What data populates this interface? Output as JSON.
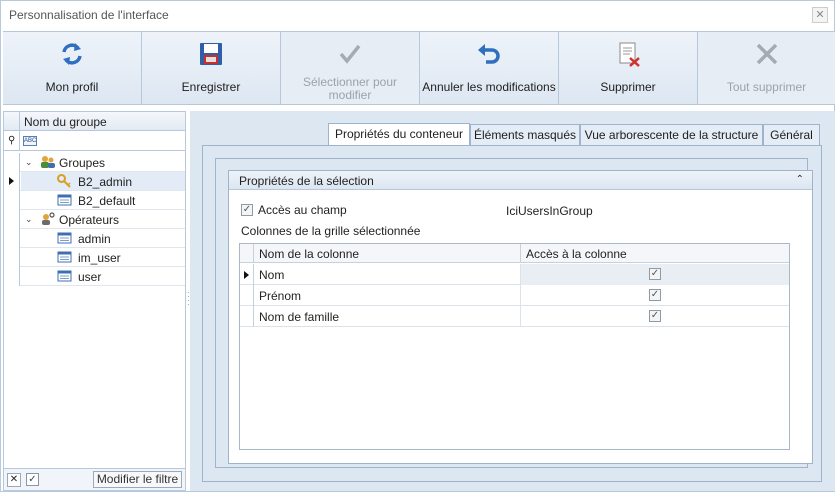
{
  "window": {
    "title": "Personnalisation de l'interface",
    "close_glyph": "✕"
  },
  "toolbar": {
    "buttons": [
      {
        "label": "Mon profil",
        "icon": "refresh-icon",
        "enabled": true
      },
      {
        "label": "Enregistrer",
        "icon": "save-icon",
        "enabled": true
      },
      {
        "label": "Sélectionner pour modifier",
        "icon": "checkmark-icon",
        "enabled": false
      },
      {
        "label": "Annuler les modifications",
        "icon": "undo-icon",
        "enabled": true
      },
      {
        "label": "Supprimer",
        "icon": "delete-document-icon",
        "enabled": true
      },
      {
        "label": "Tout supprimer",
        "icon": "x-icon",
        "enabled": false
      }
    ]
  },
  "tree": {
    "header": "Nom du groupe",
    "filter_glyph": "ABC",
    "nodes": [
      {
        "label": "Groupes",
        "level": 0,
        "expanded": true,
        "icon": "users-group-icon"
      },
      {
        "label": "B2_admin",
        "level": 1,
        "icon": "key-icon",
        "selected": true
      },
      {
        "label": "B2_default",
        "level": 1,
        "icon": "form-icon"
      },
      {
        "label": "Opérateurs",
        "level": 0,
        "expanded": true,
        "icon": "operators-icon"
      },
      {
        "label": "admin",
        "level": 1,
        "icon": "form-icon"
      },
      {
        "label": "im_user",
        "level": 1,
        "icon": "form-icon"
      },
      {
        "label": "user",
        "level": 1,
        "icon": "form-icon"
      }
    ],
    "footer": {
      "clear_glyph": "✕",
      "check_glyph": "✓",
      "edit_filter_label": "Modifier le filtre"
    }
  },
  "tabs": [
    {
      "label": "Propriétés du conteneur",
      "active": true
    },
    {
      "label": "Éléments masqués",
      "active": false
    },
    {
      "label": "Vue arborescente de la structure",
      "active": false
    },
    {
      "label": "Général",
      "active": false
    }
  ],
  "selection": {
    "title": "Propriétés de la sélection",
    "collapse_glyph": "⌃",
    "field_access_label": "Accès au champ",
    "field_access_checked": true,
    "field_name": "IciUsersInGroup",
    "grid_columns_label": "Colonnes de la grille sélectionnée",
    "check_glyph": "✓",
    "grid": {
      "columns": [
        "Nom de la colonne",
        "Accès à la colonne"
      ],
      "rows": [
        {
          "name": "Nom",
          "access": true
        },
        {
          "name": "Prénom",
          "access": true
        },
        {
          "name": "Nom de famille",
          "access": true
        }
      ]
    }
  },
  "colors": {
    "accent": "#2f6fbf",
    "toolbar_bg": "#e8eef5",
    "panel_bg": "#dde7f2",
    "border": "#b7c8dc"
  }
}
